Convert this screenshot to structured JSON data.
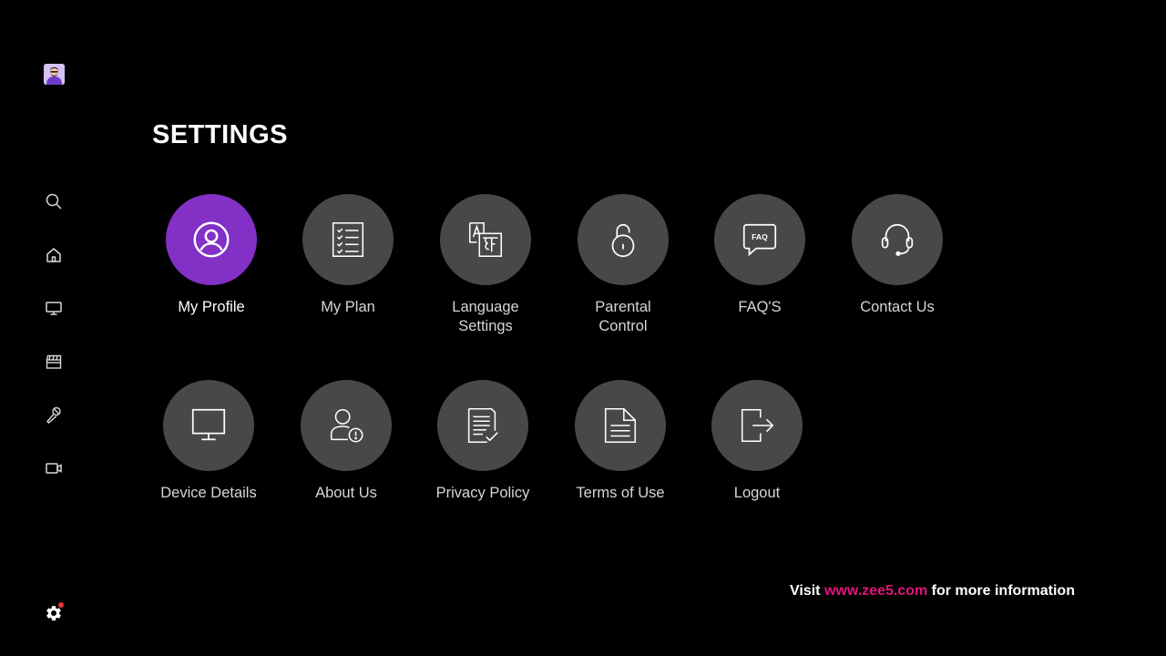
{
  "colors": {
    "background": "#000000",
    "accent_purple": "#8230C6",
    "circle_gray": "#484848",
    "link_pink": "#E0147D",
    "notification_red": "#E8323C"
  },
  "sidebar": {
    "items": [
      {
        "name": "avatar",
        "icon": "user-avatar"
      },
      {
        "name": "search",
        "icon": "search-icon"
      },
      {
        "name": "home",
        "icon": "home-icon"
      },
      {
        "name": "tv",
        "icon": "tv-icon"
      },
      {
        "name": "movies",
        "icon": "clapperboard-icon"
      },
      {
        "name": "music",
        "icon": "microphone-icon"
      },
      {
        "name": "videos",
        "icon": "video-camera-icon"
      },
      {
        "name": "settings",
        "icon": "gear-icon",
        "has_notification": true
      }
    ]
  },
  "page": {
    "title": "SETTINGS"
  },
  "tiles": [
    {
      "id": "my-profile",
      "label": "My Profile",
      "icon": "user-circle-icon",
      "selected": true
    },
    {
      "id": "my-plan",
      "label": "My Plan",
      "icon": "checklist-icon"
    },
    {
      "id": "language-settings",
      "label": "Language Settings",
      "label_line1": "Language",
      "label_line2": "Settings",
      "icon": "language-icon"
    },
    {
      "id": "parental-control",
      "label": "Parental Control",
      "label_line1": "Parental",
      "label_line2": "Control",
      "icon": "unlock-icon"
    },
    {
      "id": "faqs",
      "label": "FAQ'S",
      "icon": "faq-bubble-icon",
      "icon_text": "FAQ"
    },
    {
      "id": "contact-us",
      "label": "Contact Us",
      "icon": "headset-icon"
    },
    {
      "id": "device-details",
      "label": "Device Details",
      "icon": "monitor-icon"
    },
    {
      "id": "about-us",
      "label": "About Us",
      "icon": "user-info-icon"
    },
    {
      "id": "privacy-policy",
      "label": "Privacy Policy",
      "icon": "document-check-icon"
    },
    {
      "id": "terms-of-use",
      "label": "Terms of Use",
      "icon": "document-icon"
    },
    {
      "id": "logout",
      "label": "Logout",
      "icon": "logout-icon"
    }
  ],
  "footer": {
    "prefix": "Visit",
    "link": "www.zee5.com",
    "suffix": "for more information"
  }
}
